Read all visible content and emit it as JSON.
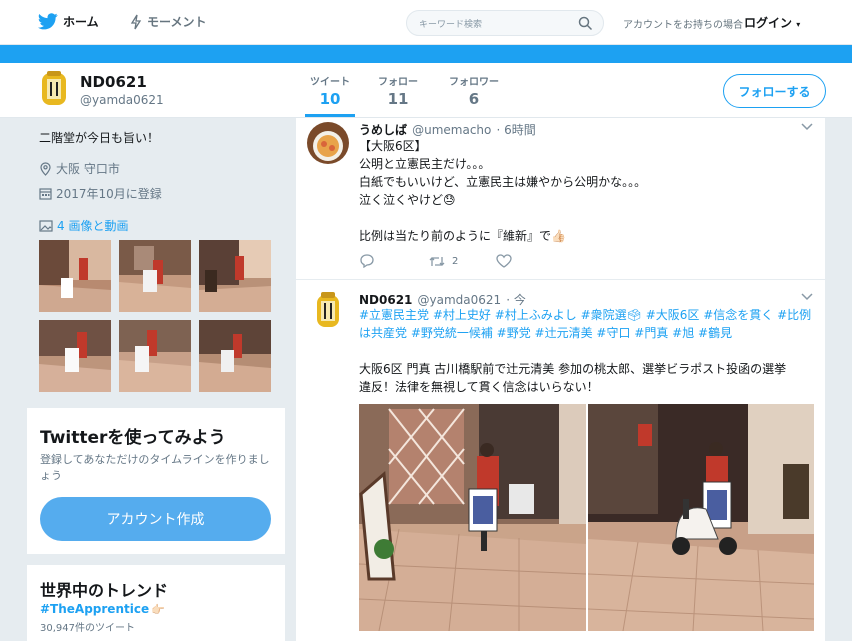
{
  "nav": {
    "home_label": "ホーム",
    "moments_label": "モーメント",
    "search_placeholder": "キーワード検索",
    "have_account_text": "アカウントをお持ちの場合",
    "login_label": "ログイン",
    "brand_color": "#1da1f2"
  },
  "profile": {
    "name": "ND0621",
    "handle": "@yamda0621",
    "stats": [
      {
        "label": "ツイート",
        "value": "10"
      },
      {
        "label": "フォロー",
        "value": "11"
      },
      {
        "label": "フォロワー",
        "value": "6"
      }
    ],
    "follow_label": "フォローする",
    "bio": "二階堂が今日も旨い！",
    "location": "大阪 守口市",
    "joined": "2017年10月に登録",
    "media_link": "4 画像と動画"
  },
  "signup": {
    "title": "Twitterを使ってみよう",
    "text": "登録してあなただけのタイムラインを作りましょう",
    "button_label": "アカウント作成"
  },
  "trends": {
    "title": "世界中のトレンド",
    "items": [
      {
        "tag": "#TheApprentice",
        "count": "30,947件のツイート"
      }
    ]
  },
  "tweets": [
    {
      "name": "うめしば",
      "handle": "@umemacho",
      "time": "· 6時間",
      "lines": [
        "【大阪6区】",
        "公明と立憲民主だけ。。。",
        "白紙でもいいけど、立憲民主は嫌やから公明かな。。。",
        "泣く泣くやけど😓",
        "",
        "比例は当たり前のように『維新』で👍🏻"
      ],
      "retweet_count": "2"
    },
    {
      "name": "ND0621",
      "handle": "@yamda0621",
      "time": "· 今",
      "hashtags_line1": "#立憲民主党 #村上史好 #村上ふみよし #衆院選🗳 #大阪6区 #信念を貫く #比例",
      "hashtags_line2": "は共産党 #野党統一候補 #野党 #辻元清美 #守口 #門真 #旭 #鶴見",
      "body_line1": "大阪6区 門真 古川橋駅前で辻元清美 参加の桃太郎、選挙ビラポスト投函の選挙",
      "body_line2": "違反！法律を無視して貫く信念はいらない！"
    }
  ]
}
